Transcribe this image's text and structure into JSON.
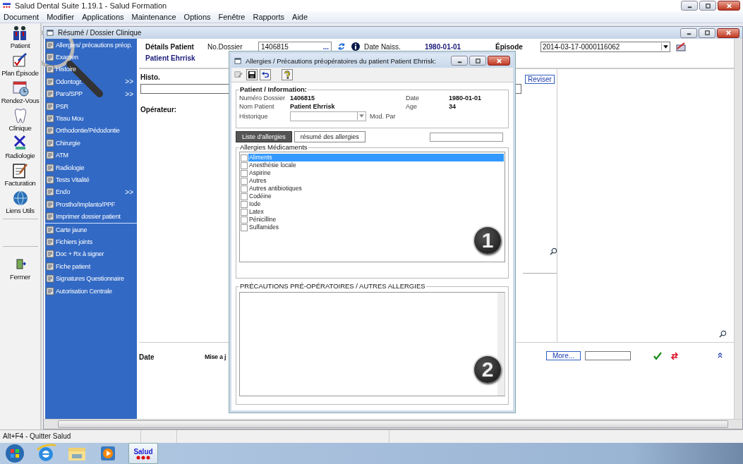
{
  "window": {
    "title": "Salud Dental Suite 1.19.1 - Salud Formation"
  },
  "menu": [
    "Document",
    "Modifier",
    "Applications",
    "Maintenance",
    "Options",
    "Fenêtre",
    "Rapports",
    "Aide"
  ],
  "toolbar": [
    {
      "label": "Patient"
    },
    {
      "label": "Plan Épisode"
    },
    {
      "label": "Rendez-Vous"
    },
    {
      "label": "Clinique"
    },
    {
      "label": "Radiologie"
    },
    {
      "label": "Facturation"
    },
    {
      "label": "Liens Utils"
    }
  ],
  "close_tool": {
    "label": "Fermer"
  },
  "child_window": {
    "title": "Résumé / Dossier Clinique"
  },
  "nav_menu": {
    "sections": [
      [
        {
          "label": "Allergies/ précautions préop."
        },
        {
          "label": "Examen"
        },
        {
          "label": "Histoire"
        },
        {
          "label": "Odontogr.",
          "arrow": ">>"
        },
        {
          "label": "Paro/SPP",
          "arrow": ">>"
        },
        {
          "label": "PSR"
        },
        {
          "label": "Tissu Mou"
        },
        {
          "label": "Orthodontie/Pédodontie"
        },
        {
          "label": "Chirurgie"
        },
        {
          "label": "ATM"
        },
        {
          "label": "Radiologie"
        },
        {
          "label": "Tests Vitalité"
        },
        {
          "label": "Endo",
          "arrow": ">>"
        },
        {
          "label": "Prostho/Implanto/PPF"
        },
        {
          "label": "Imprimer dossier patient"
        }
      ],
      [
        {
          "label": "Carte jaune"
        },
        {
          "label": "Fichiers joints"
        },
        {
          "label": "Doc + Rx à signer"
        },
        {
          "label": "Fiche patient"
        },
        {
          "label": "Signatures Questionnaire"
        },
        {
          "label": "Autorisation Centrale"
        }
      ]
    ]
  },
  "patient_header": {
    "details_label": "Détails Patient",
    "dossier_label": "No.Dossier",
    "dossier_value": "1406815",
    "lookup_button": "...",
    "birth_label": "Date Naiss.",
    "birth_value": "1980-01-01",
    "episode_label": "Épisode",
    "episode_value": "2014-03-17-0000116062",
    "patient_name": "Patient Ehrrisk"
  },
  "histo": {
    "label": "Histo.",
    "operator_label": "Opérateur:",
    "revise_button": "Reviser"
  },
  "footer": {
    "date_label": "Date",
    "update_label": "Mise a j",
    "more_button": "More..."
  },
  "dialog": {
    "title": "Allergies / Précautions préopératoires du patient Patient Ehrrisk:",
    "info_legend": "Patient / Information:",
    "fields": {
      "dossier_label": "Numéro Dossier",
      "dossier_value": "1406815",
      "name_label": "Nom Patient",
      "name_value": "Patient Ehrrisk",
      "date_label": "Date",
      "date_value": "1980-01-01",
      "age_label": "Age",
      "age_value": "34",
      "history_label": "Historique",
      "modified_label": "Mod. Par"
    },
    "tabs": [
      {
        "label": "Liste d'allergies",
        "selected": true
      },
      {
        "label": "résumé des allergies",
        "selected": false
      }
    ],
    "list_legend": "Allergies Médicaments",
    "allergies": [
      {
        "label": "Aliments",
        "checked": false,
        "selected": true
      },
      {
        "label": "Anesthésie locale",
        "checked": false,
        "selected": false
      },
      {
        "label": "Aspirine",
        "checked": false,
        "selected": false
      },
      {
        "label": "Autres",
        "checked": false,
        "selected": false
      },
      {
        "label": "Autres antibiotiques",
        "checked": false,
        "selected": false
      },
      {
        "label": "Codéine",
        "checked": false,
        "selected": false
      },
      {
        "label": "Iode",
        "checked": false,
        "selected": false
      },
      {
        "label": "Latex",
        "checked": false,
        "selected": false
      },
      {
        "label": "Pénicilline",
        "checked": false,
        "selected": false
      },
      {
        "label": "Sulfamides",
        "checked": false,
        "selected": false
      }
    ],
    "precautions_legend": "PRÉCAUTIONS PRÉ-OPÉRATOIRES / AUTRES ALLERGIES",
    "callouts": [
      "1",
      "2"
    ]
  },
  "status_bar": [
    "Alt+F4 - Quitter Salud"
  ],
  "taskbar": {
    "active_app": "Salud"
  }
}
